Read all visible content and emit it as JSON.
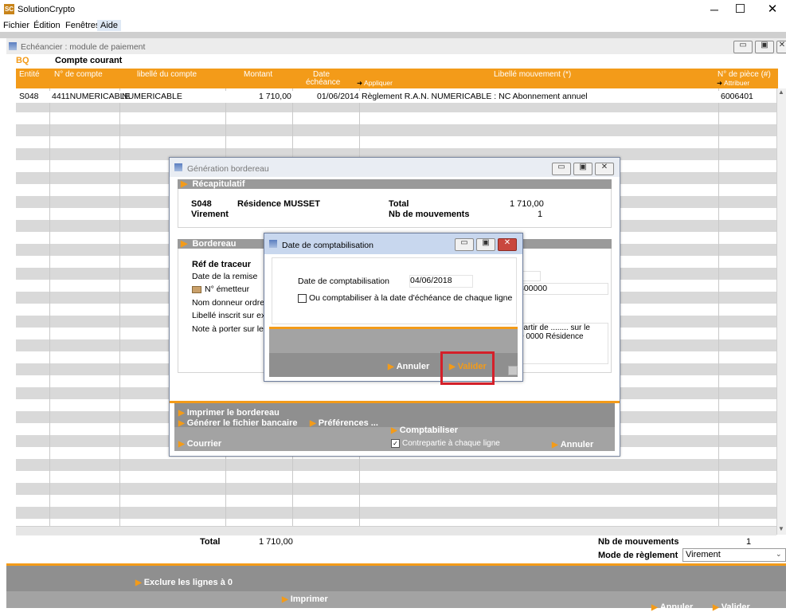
{
  "app": {
    "title": "SolutionCrypto",
    "icon_text": "SC",
    "menu": [
      "Fichier",
      "Édition",
      "Fenêtres",
      "Aide"
    ]
  },
  "main_window": {
    "title": "Echéancier : module de paiement",
    "journal_code": "BQ",
    "journal_label": "Compte courant",
    "columns": {
      "entite": "Entité",
      "compte": "N° de compte",
      "libelle_compte": "libellé  du compte",
      "montant": "Montant",
      "date": "Date",
      "date2": "échéance",
      "appliquer": "Appliquer",
      "libelle_mvt": "Libellé mouvement  (*)",
      "piece": "N° de pièce (#)",
      "attribuer": "Attribuer"
    },
    "rows": [
      {
        "entite": "S048",
        "compte": "4411NUMERICABLE",
        "libelle_compte": "NUMERICABLE",
        "montant": "1 710,00",
        "date": "01/06/2014",
        "libelle": "Règlement R.A.N. NUMERICABLE : NC Abonnement annuel",
        "piece": "6006401"
      }
    ],
    "total_label": "Total",
    "total_value": "1 710,00",
    "nb_mvt_label": "Nb de mouvements",
    "nb_mvt_value": "1",
    "mode_reglement_label": "Mode de règlement",
    "mode_reglement_value": "Virement",
    "exclure_label": "Exclure les lignes à 0",
    "imprimer_label": "Imprimer",
    "annuler_label": "Annuler",
    "valider_label": "Valider"
  },
  "bordereau_window": {
    "title": "Génération bordereau",
    "recap_header": "Récapitulatif",
    "entity_code": "S048",
    "entity_name": "Résidence MUSSET",
    "payment_type": "Virement",
    "total_label": "Total",
    "total_value": "1 710,00",
    "nb_mvt_label": "Nb de mouvements",
    "nb_mvt_value": "1",
    "bordereau_header": "Bordereau",
    "ref_traceur": "Réf de traceur",
    "date_remise": "Date de la remise",
    "emetteur": "N° émetteur",
    "emetteur_value": "300000",
    "nom_donneur": "Nom donneur ordre",
    "libelle_extrait": "Libellé inscrit sur extr",
    "note": "Note à porter sur le l",
    "note_value_line1": "partir de ........ sur le",
    "note_value_line2": "0 0000 Résidence",
    "imprimer_bordereau": "Imprimer le bordereau",
    "generer_fichier": "Générer le fichier bancaire",
    "preferences": "Préférences ...",
    "comptabiliser": "Comptabiliser",
    "contrepartie": "Contrepartie à chaque ligne",
    "courrier": "Courrier",
    "annuler": "Annuler"
  },
  "date_dialog": {
    "title": "Date de comptabilisation",
    "date_label": "Date de comptabilisation",
    "date_value": "04/06/2018",
    "checkbox_label": "Ou comptabiliser à la date d'échéance de chaque ligne",
    "annuler": "Annuler",
    "valider": "Valider"
  },
  "colors": {
    "accent_orange": "#f39b19",
    "panel_gray": "#8f8f8f",
    "highlight_red": "#d4202a"
  }
}
